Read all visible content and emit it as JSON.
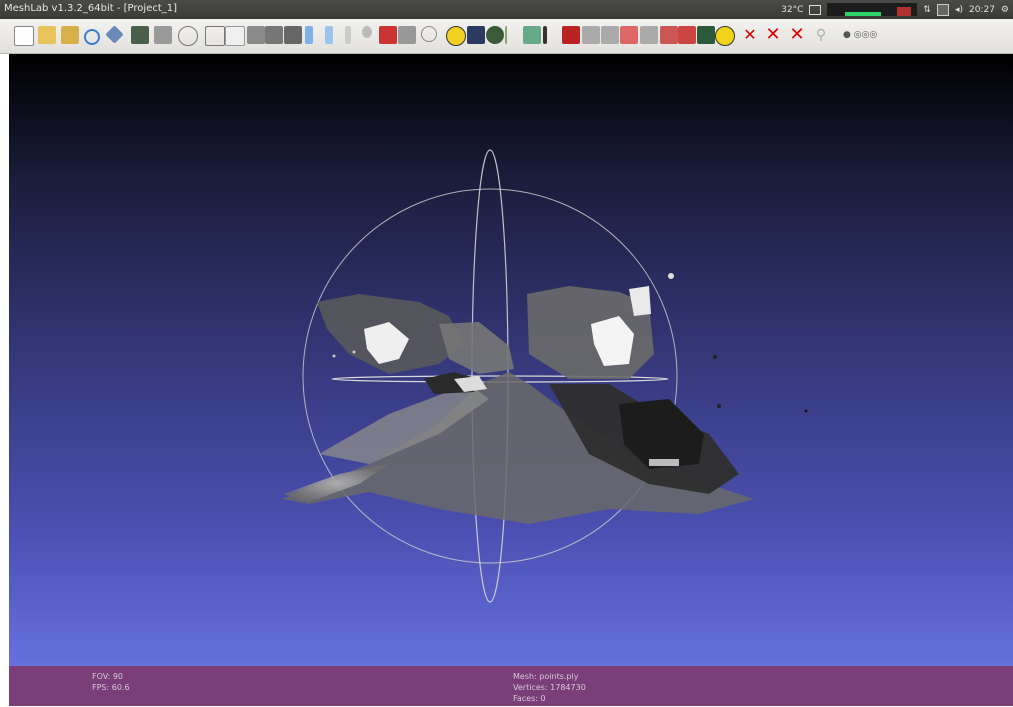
{
  "window": {
    "title": "MeshLab v1.3.2_64bit - [Project_1]"
  },
  "tray": {
    "temperature": "32°C",
    "time": "20:27"
  },
  "toolbar": {
    "icons": [
      "new-document-icon",
      "open-icon",
      "open-project-icon",
      "reload-icon",
      "save-icon",
      "snapshot-icon",
      "layers-icon",
      "bbox-icon",
      "points-render-icon",
      "wireframe-render-icon",
      "hidden-lines-icon",
      "flat-lines-icon",
      "flat-render-icon",
      "smooth-render-icon",
      "texture-render-icon",
      "light-bulb-icon",
      "double-light-icon",
      "backface-icon",
      "axis-icon",
      "annotation-icon",
      "color-icon",
      "measure-icon",
      "paint-icon",
      "brush-icon",
      "mask-icon",
      "align-icon",
      "pick-points-icon",
      "select-region-icon",
      "select-vertex-icon",
      "select-face-icon",
      "z-paint-icon",
      "info-icon",
      "delete-vertices-icon",
      "delete-faces-icon",
      "delete-all-icon",
      "search-icon",
      "zoom-controls-icon"
    ]
  },
  "status": {
    "fov": "FOV: 90",
    "fps": "FPS:   60.6",
    "mesh": "Mesh: points.ply",
    "vertices": "Vertices: 1784730",
    "faces": "Faces: 0"
  },
  "colors": {
    "status_bar": "#7a3f78",
    "background_top": "#000000",
    "background_bottom": "#6670de"
  }
}
